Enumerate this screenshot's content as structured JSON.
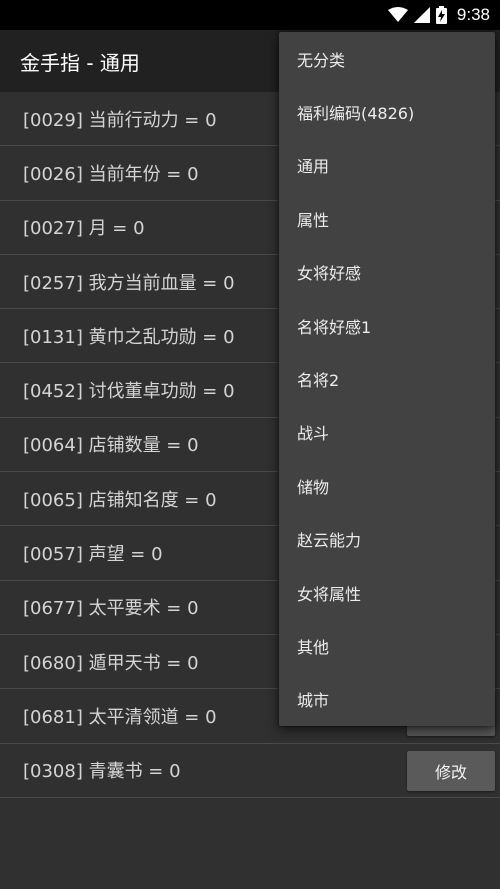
{
  "status_bar": {
    "time": "9:38",
    "icons": [
      "wifi-icon",
      "cell-signal-icon",
      "battery-charging-icon"
    ]
  },
  "toolbar": {
    "title": "金手指 - 通用"
  },
  "list": {
    "rows": [
      {
        "label": "[0029] 当前行动力 = 0"
      },
      {
        "label": "[0026] 当前年份 = 0"
      },
      {
        "label": "[0027] 月 = 0"
      },
      {
        "label": "[0257] 我方当前血量 = 0"
      },
      {
        "label": "[0131] 黄巾之乱功勋 = 0"
      },
      {
        "label": "[0452] 讨伐董卓功勋 = 0"
      },
      {
        "label": "[0064] 店铺数量 = 0"
      },
      {
        "label": "[0065] 店铺知名度 = 0"
      },
      {
        "label": "[0057] 声望 = 0"
      },
      {
        "label": "[0677] 太平要术 = 0"
      },
      {
        "label": "[0680] 遁甲天书 = 0"
      },
      {
        "label": "[0681] 太平清领道 = 0"
      },
      {
        "label": "[0308] 青囊书 = 0"
      }
    ],
    "modify_label": "修改"
  },
  "dropdown": {
    "items": [
      "无分类",
      "福利编码(4826)",
      "通用",
      "属性",
      "女将好感",
      "名将好感1",
      "名将2",
      "战斗",
      "储物",
      "赵云能力",
      "女将属性",
      "其他",
      "城市"
    ]
  },
  "colors": {
    "background": "#303030",
    "toolbar": "#212121",
    "menu": "#424242",
    "button": "#5a5a5a"
  }
}
